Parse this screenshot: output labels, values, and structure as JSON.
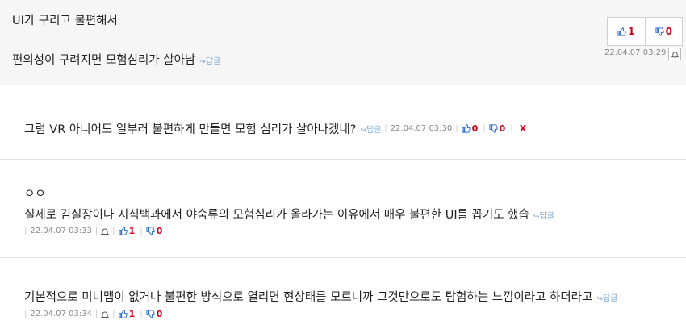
{
  "comment1": {
    "line1": "UI가 구리고 불편해서",
    "line2": "편의성이 구려지면 모험심리가 살아남",
    "reply_label": "답글",
    "upvotes": "1",
    "downvotes": "0",
    "timestamp": "22.04.07 03:29"
  },
  "comment2": {
    "text": "그럼 VR 아니어도 일부러 불편하게 만들면 모험 심리가 살아나겠네?",
    "reply_label": "답글",
    "timestamp": "22.04.07 03:30",
    "upvotes": "0",
    "downvotes": "0",
    "delete_label": "X"
  },
  "comment3": {
    "line1": "ㅇㅇ",
    "line2": "실제로 김실장이나 지식백과에서 야숨류의 모험심리가 올라가는 이유에서 매우 불편한 UI를 꼽기도 했습",
    "reply_label": "답글",
    "timestamp": "22.04.07 03:33",
    "upvotes": "1",
    "downvotes": "0"
  },
  "comment4": {
    "text": "기본적으로 미니맵이 없거나 불편한 방식으로 열리면 현상태를 모르니까 그것만으로도 탐험하는 느낌이라고 하더라고",
    "reply_label": "답글",
    "timestamp": "22.04.07 03:34",
    "upvotes": "1",
    "downvotes": "0"
  },
  "colors": {
    "accent_red": "#d0021b",
    "reply_blue": "#7aa3d6",
    "thumb_blue": "#2f6fc9",
    "meta_gray": "#888888"
  },
  "icons": [
    "thumbs-up-icon",
    "thumbs-down-icon",
    "bell-icon",
    "reply-arrow-icon"
  ]
}
